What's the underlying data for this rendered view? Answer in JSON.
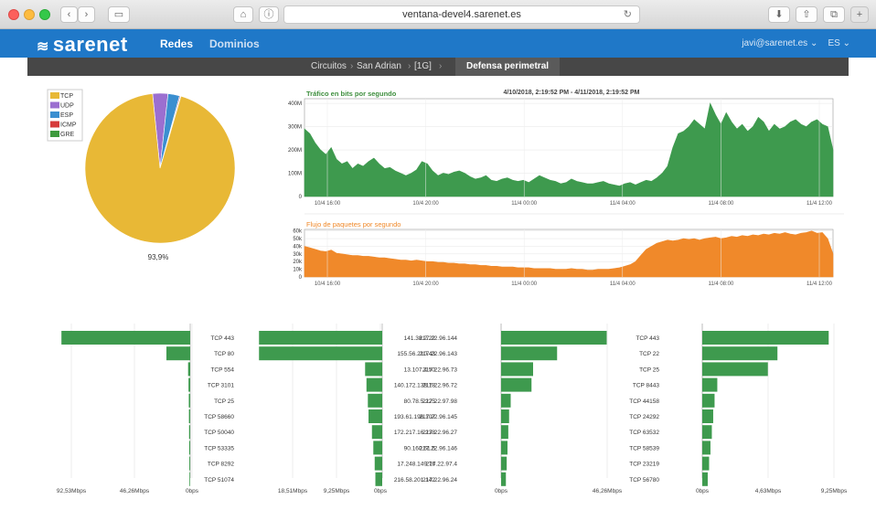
{
  "browser": {
    "url": "ventana-devel4.sarenet.es"
  },
  "nav": {
    "logo": "sarenet",
    "links": [
      "Redes",
      "Dominios"
    ],
    "user": "javi@sarenet.es",
    "lang": "ES"
  },
  "breadcrumb": {
    "items": [
      "Circuitos",
      "San Adrian",
      "[1G]"
    ],
    "active": "Defensa perimetral"
  },
  "pie": {
    "legend": [
      {
        "label": "TCP",
        "color": "#e8b836"
      },
      {
        "label": "UDP",
        "color": "#9b6fd0"
      },
      {
        "label": "ESP",
        "color": "#3b8fd0"
      },
      {
        "label": "ICMP",
        "color": "#d63b3b"
      },
      {
        "label": "GRE",
        "color": "#3e9a3e"
      }
    ],
    "values": [
      93.9,
      3.3,
      2.5,
      0.2,
      0.1
    ],
    "percent_label": "93,9%"
  },
  "chart_data": [
    {
      "type": "area",
      "title": "Tráfico en bits por segundo",
      "subtitle": "4/10/2018, 2:19:52 PM - 4/11/2018, 2:19:52 PM",
      "x_ticks": [
        "10/4 16:00",
        "10/4 20:00",
        "11/4 00:00",
        "11/4 04:00",
        "11/4 08:00",
        "11/4 12:00"
      ],
      "y_ticks": [
        "0",
        "100M",
        "200M",
        "300M",
        "400M"
      ],
      "ylim": [
        0,
        420
      ],
      "color": "#3e9a4e",
      "values": [
        290,
        270,
        230,
        200,
        180,
        210,
        160,
        140,
        150,
        120,
        140,
        130,
        150,
        165,
        140,
        120,
        125,
        110,
        100,
        90,
        100,
        115,
        150,
        140,
        110,
        90,
        100,
        95,
        105,
        110,
        100,
        85,
        75,
        80,
        90,
        70,
        65,
        75,
        80,
        70,
        65,
        70,
        60,
        75,
        90,
        80,
        70,
        65,
        55,
        60,
        75,
        65,
        60,
        55,
        55,
        60,
        65,
        55,
        50,
        45,
        55,
        60,
        50,
        60,
        70,
        65,
        80,
        100,
        130,
        210,
        270,
        280,
        300,
        330,
        310,
        290,
        400,
        350,
        310,
        360,
        320,
        290,
        310,
        280,
        300,
        340,
        320,
        280,
        310,
        290,
        300,
        320,
        330,
        310,
        300,
        320,
        330,
        310,
        300,
        200
      ]
    },
    {
      "type": "area",
      "title": "Flujo de paquetes por segundo",
      "x_ticks": [
        "10/4 16:00",
        "10/4 20:00",
        "11/4 00:00",
        "11/4 04:00",
        "11/4 08:00",
        "11/4 12:00"
      ],
      "y_ticks": [
        "0",
        "10k",
        "20k",
        "30k",
        "40k",
        "50k",
        "60k"
      ],
      "ylim": [
        0,
        62
      ],
      "color": "#f0892a",
      "values": [
        40,
        38,
        36,
        34,
        33,
        35,
        31,
        30,
        29,
        28,
        28,
        27,
        27,
        26,
        25,
        25,
        24,
        23,
        22,
        22,
        21,
        22,
        21,
        20,
        20,
        19,
        19,
        18,
        18,
        17,
        17,
        16,
        16,
        15,
        15,
        14,
        14,
        13,
        13,
        13,
        12,
        12,
        12,
        11,
        11,
        11,
        11,
        10,
        10,
        10,
        11,
        10,
        10,
        9,
        9,
        10,
        10,
        10,
        11,
        12,
        14,
        16,
        20,
        28,
        36,
        40,
        44,
        46,
        48,
        47,
        48,
        50,
        49,
        50,
        48,
        50,
        51,
        52,
        50,
        51,
        53,
        52,
        54,
        53,
        55,
        54,
        56,
        55,
        57,
        56,
        58,
        56,
        55,
        57,
        58,
        60,
        57,
        58,
        50,
        30
      ]
    },
    {
      "type": "bar",
      "orientation": "horizontal",
      "categories": [
        "TCP 443",
        "TCP 80",
        "TCP 554",
        "TCP 3101",
        "TCP 25",
        "TCP 58660",
        "TCP 50040",
        "TCP 53335",
        "TCP 8292",
        "TCP 51074"
      ],
      "values": [
        92.0,
        17.0,
        1.5,
        1.2,
        1.0,
        0.9,
        0.8,
        0.7,
        0.6,
        0.5
      ],
      "x_ticks": [
        "92,53Mbps",
        "46,26Mbps",
        "0bps"
      ],
      "xlim": [
        0,
        98
      ],
      "direction": "right-to-left",
      "color": "#3e9a4e"
    },
    {
      "type": "bar",
      "orientation": "horizontal",
      "categories": [
        "141.38.2.22",
        "155.56.210.43",
        "13.107.4.50",
        "140.172.138.18",
        "80.78.5.225",
        "193.61.196.107",
        "172.217.16.238",
        "90.160.61.5",
        "17.248.149.76",
        "216.58.201.142"
      ],
      "values": [
        18.0,
        18.0,
        2.5,
        2.3,
        2.1,
        2.0,
        1.5,
        1.3,
        1.1,
        1.0
      ],
      "x_ticks": [
        "18,51Mbps",
        "9,25Mbps",
        "0bps"
      ],
      "xlim": [
        0,
        18.7
      ],
      "direction": "right-to-left",
      "color": "#3e9a4e"
    },
    {
      "type": "bar",
      "orientation": "horizontal",
      "categories": [
        "217.22.96.144",
        "217.22.96.143",
        "217.22.96.73",
        "217.22.96.72",
        "217.22.97.98",
        "217.22.96.145",
        "217.22.96.27",
        "217.22.96.146",
        "217.22.97.4",
        "217.22.96.24"
      ],
      "values": [
        66.0,
        35.0,
        20.0,
        19.0,
        6.0,
        5.0,
        4.5,
        4.0,
        3.5,
        3.0
      ],
      "x_ticks": [
        "0bps",
        "46,26Mbps"
      ],
      "xlim": [
        0,
        80
      ],
      "direction": "left-to-right",
      "color": "#3e9a4e"
    },
    {
      "type": "bar",
      "orientation": "horizontal",
      "categories": [
        "TCP 443",
        "TCP 22",
        "TCP 25",
        "TCP 8443",
        "TCP 44158",
        "TCP 24292",
        "TCP 63532",
        "TCP 58539",
        "TCP 23219",
        "TCP 56780"
      ],
      "values": [
        9.25,
        5.5,
        4.8,
        1.1,
        0.9,
        0.8,
        0.7,
        0.6,
        0.5,
        0.4
      ],
      "x_ticks": [
        "0bps",
        "4,63Mbps",
        "9,25Mbps"
      ],
      "xlim": [
        0,
        9.7
      ],
      "direction": "left-to-right",
      "color": "#3e9a4e"
    }
  ]
}
